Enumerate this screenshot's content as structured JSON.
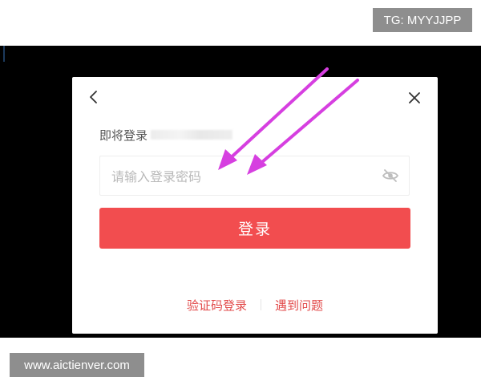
{
  "watermarks": {
    "tg": "TG: MYYJJPP",
    "site": "www.aictienver.com"
  },
  "dialog": {
    "back_icon": "chevron-left-icon",
    "close_icon": "close-icon",
    "prompt_label": "即将登录",
    "password": {
      "value": "",
      "placeholder": "请输入登录密码",
      "toggle_icon": "eye-off-icon"
    },
    "login_button_label": "登录",
    "links": {
      "sms_login": "验证码登录",
      "help": "遇到问题"
    }
  },
  "annotations": {
    "arrow_color": "#d63fe0",
    "arrow_icon": "arrow-annotation-icon"
  },
  "colors": {
    "accent": "#f24d4f",
    "link": "#e24a4a",
    "backdrop": "#000000"
  }
}
